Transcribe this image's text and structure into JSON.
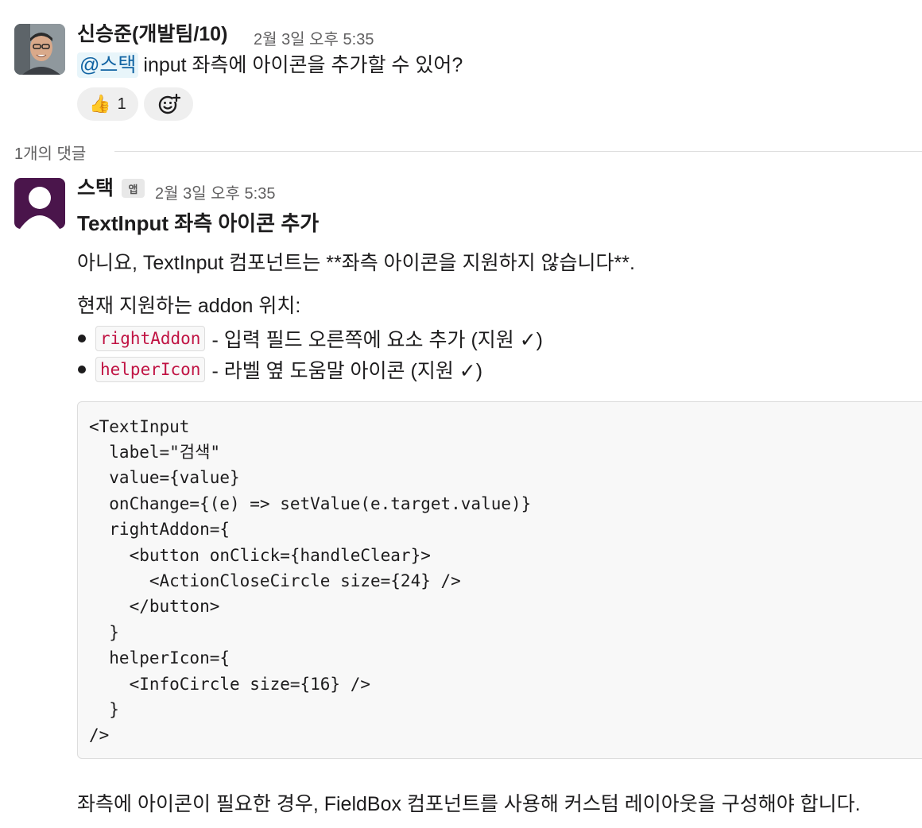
{
  "message1": {
    "author": "신승준(개발팀/10)",
    "timestamp": "2월 3일 오후 5:35",
    "mention": "@스택",
    "text": "input 좌측에 아이콘을 추가할 수 있어?",
    "reactions": [
      {
        "emoji": "👍",
        "count": "1"
      }
    ],
    "add_reaction_icon": "add-reaction-icon"
  },
  "thread": {
    "reply_count_label": "1개의 댓글"
  },
  "message2": {
    "author": "스택",
    "badge": "앱",
    "timestamp": "2월 3일 오후 5:35",
    "title": "TextInput 좌측 아이콘 추가",
    "paragraph1": "아니요, TextInput 컴포넌트는 **좌측 아이콘을 지원하지 않습니다**.",
    "addon_heading": "현재 지원하는 addon 위치:",
    "bullets": [
      {
        "code": "rightAddon",
        "text": "- 입력 필드 오른쪽에 요소 추가 (지원 ✓)"
      },
      {
        "code": "helperIcon",
        "text": "- 라벨 옆 도움말 아이콘 (지원 ✓)"
      }
    ],
    "code_lines": [
      "<TextInput",
      "  label=\"검색\"",
      "  value={value}",
      "  onChange={(e) => setValue(e.target.value)}",
      "  rightAddon={",
      "    <button onClick={handleClear}>",
      "      <ActionCloseCircle size={24} />",
      "    </button>",
      "  }",
      "  helperIcon={",
      "    <InfoCircle size={16} />",
      "  }",
      "/>"
    ],
    "closing": "좌측에 아이콘이 필요한 경우, FieldBox 컴포넌트를 사용해 커스텀 레이아웃을 구성해야 합니다."
  },
  "colors": {
    "mention_bg": "#e8f5fa",
    "mention_text": "#1264a3",
    "inline_code": "#c01343",
    "app_avatar": "#4a154b"
  }
}
